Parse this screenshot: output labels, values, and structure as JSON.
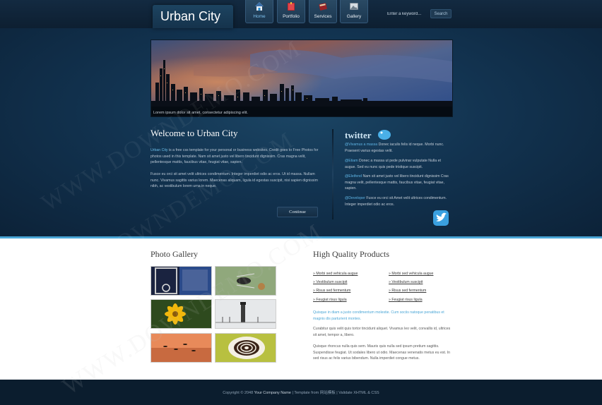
{
  "site": {
    "title": "Urban City"
  },
  "nav": {
    "items": [
      {
        "label": "Home",
        "icon": "home-icon",
        "active": true
      },
      {
        "label": "Portfolio",
        "icon": "portfolio-icon",
        "active": false
      },
      {
        "label": "Services",
        "icon": "services-icon",
        "active": false
      },
      {
        "label": "Gallery",
        "icon": "gallery-icon",
        "active": false
      }
    ]
  },
  "search": {
    "placeholder": "Enter a keyword...",
    "button_label": "Search"
  },
  "banner": {
    "caption": "Lorem ipsum dolor sit amet, consectetur adipiscing elit."
  },
  "welcome": {
    "title": "Welcome to Urban City",
    "p1_highlight": "Urban City",
    "p1_text": " is a free css template for your personal or business websites. Credit goes to Free Photos for photos used in this template. Nam sit amet justo vel libero tincidunt dignissim. Cras magna velit, pellentesque mattis, faucibus vitae, feugiat vitae, sapien.",
    "p2_text": "Fusce eu orci sit amet velit ultrices condimentum. Integer imperdiet odio ac eros. Ut id massa. Nullam nunc. Vivamus sagittis varius lorem. Maecenas aliquam, ligula id egestas suscipit, nisi sapien dignissim nibh, ac vestibulum lorem urna in neque.",
    "continue_label": "Continue"
  },
  "twitter": {
    "logo_text": "twitter",
    "tweets": [
      {
        "user": "@Vivamus a massa",
        "text": " Donec iaculis felis id neque. Morbi nunc. Praesent varius egestas velit."
      },
      {
        "user": "@Etiam",
        "text": " Donec a massa ut pede pulvinar vulputate Nulla et augue. Sed eu nunc quis pede tristique suscipit."
      },
      {
        "user": "@Eleifend",
        "text": " Nam sit amet justo vel libero tincidunt dignissim Cras magna velit, pellentesque mattis, faucibus vitae, feugiat vitae, sapien."
      },
      {
        "user": "@Developer",
        "text": " Fusce eu orci sit Amet velit ultrices condimentum. Integer imperdiet odio ac eros."
      }
    ]
  },
  "gallery": {
    "title": "Photo Gallery"
  },
  "products": {
    "title": "High Quality Products",
    "links_left": [
      "» Morbi sed vehicula augue",
      "» Vestibulum suscipit",
      "» Risus sed fermentum",
      "» Feugiat risus ligula"
    ],
    "links_right": [
      "» Morbi sed vehicula augue",
      "» Vestibulum suscipit",
      "» Risus sed fermentum",
      "» Feugiat risus ligula"
    ],
    "highlight": "Quisque in diam a justo condimentum molestie. Cum sociis natoque penatibus et magnis dis parturient montes.",
    "p1": "Curabitur quis velit quis tortor tincidunt aliquet. Vivamus leo velit, convallis id, ultrices sit amet, tempor a, libero.",
    "p2": "Quisque rhoncus nulla quis sem. Mauris quis nulla sed ipsum pretium sagittis. Suspendisse feugiat. Ut sodales libero ut odio. Maecenas venenatis metus eu est. In sed risus ac felis varius bibendum. Nulla imperdiet congue metus."
  },
  "footer": {
    "copyright_prefix": "Copyright © 2048 ",
    "company": "Your Company Name",
    "sep1": " | Template from ",
    "template_from": "网站模板",
    "sep2": " | Validate XHTML & CSS"
  },
  "watermark": {
    "text": "WWW.DOWNDEMO.COM"
  },
  "colors": {
    "accent": "#4aa6d6",
    "header_bg": "#0f2236",
    "content_bg": "#ffffff"
  }
}
